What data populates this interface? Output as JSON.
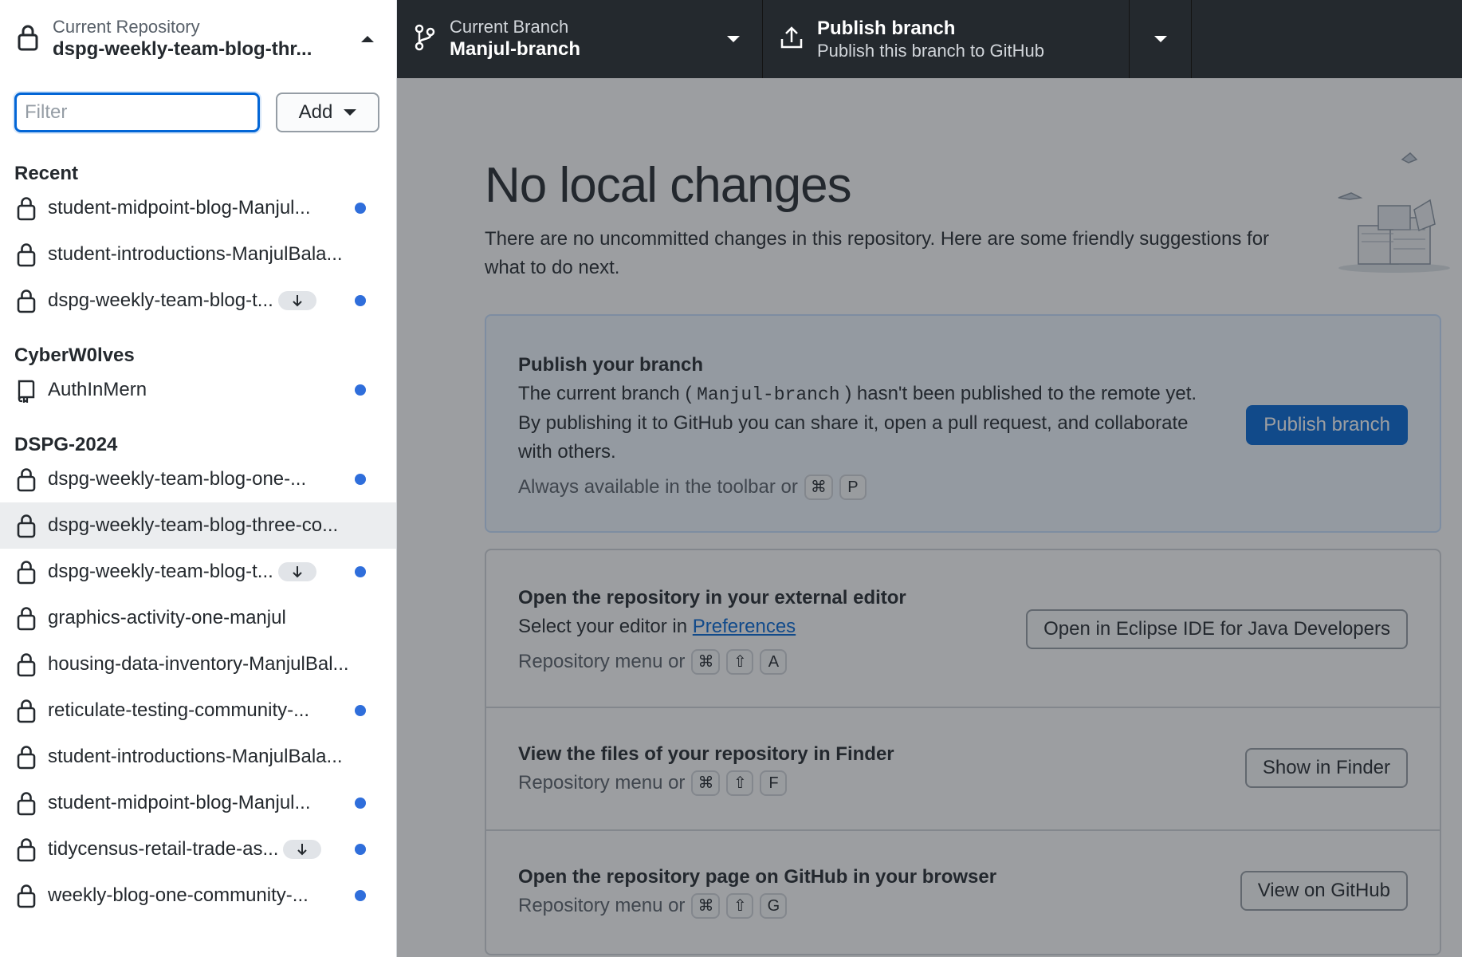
{
  "toolbar": {
    "repo_label": "Current Repository",
    "repo_name": "dspg-weekly-team-blog-thr...",
    "branch_label": "Current Branch",
    "branch_name": "Manjul-branch",
    "publish_title": "Publish branch",
    "publish_subtitle": "Publish this branch to GitHub"
  },
  "sidebar": {
    "filter_placeholder": "Filter",
    "add_label": "Add",
    "groups": [
      {
        "title": "Recent",
        "items": [
          {
            "name": "student-midpoint-blog-Manjul...",
            "icon": "lock-icon",
            "dot": true,
            "pull": false
          },
          {
            "name": "student-introductions-ManjulBala...",
            "icon": "lock-icon",
            "dot": false,
            "pull": false
          },
          {
            "name": "dspg-weekly-team-blog-t...",
            "icon": "lock-icon",
            "dot": true,
            "pull": true
          }
        ]
      },
      {
        "title": "CyberW0lves",
        "items": [
          {
            "name": "AuthInMern",
            "icon": "repo-icon",
            "dot": true,
            "pull": false
          }
        ]
      },
      {
        "title": "DSPG-2024",
        "items": [
          {
            "name": "dspg-weekly-team-blog-one-...",
            "icon": "lock-icon",
            "dot": true,
            "pull": false
          },
          {
            "name": "dspg-weekly-team-blog-three-co...",
            "icon": "lock-icon",
            "dot": false,
            "pull": false,
            "selected": true
          },
          {
            "name": "dspg-weekly-team-blog-t...",
            "icon": "lock-icon",
            "dot": true,
            "pull": true
          },
          {
            "name": "graphics-activity-one-manjul",
            "icon": "lock-icon",
            "dot": false,
            "pull": false
          },
          {
            "name": "housing-data-inventory-ManjulBal...",
            "icon": "lock-icon",
            "dot": false,
            "pull": false
          },
          {
            "name": "reticulate-testing-community-...",
            "icon": "lock-icon",
            "dot": true,
            "pull": false
          },
          {
            "name": "student-introductions-ManjulBala...",
            "icon": "lock-icon",
            "dot": false,
            "pull": false
          },
          {
            "name": "student-midpoint-blog-Manjul...",
            "icon": "lock-icon",
            "dot": true,
            "pull": false
          },
          {
            "name": "tidycensus-retail-trade-as...",
            "icon": "lock-icon",
            "dot": true,
            "pull": true
          },
          {
            "name": "weekly-blog-one-community-...",
            "icon": "lock-icon",
            "dot": true,
            "pull": false
          }
        ]
      }
    ]
  },
  "main": {
    "headline": "No local changes",
    "subtext": "There are no uncommitted changes in this repository. Here are some friendly suggestions for what to do next.",
    "publish": {
      "title": "Publish your branch",
      "desc_before": "The current branch ( ",
      "branch_code": "Manjul-branch",
      "desc_after": " ) hasn't been published to the remote yet. By publishing it to GitHub you can share it, open a pull request, and collaborate with others.",
      "hint": "Always available in the toolbar or",
      "keys": [
        "⌘",
        "P"
      ],
      "button": "Publish branch"
    },
    "editor": {
      "title": "Open the repository in your external editor",
      "desc_prefix": "Select your editor in ",
      "desc_link": "Preferences",
      "hint": "Repository menu or",
      "keys": [
        "⌘",
        "⇧",
        "A"
      ],
      "button": "Open in Eclipse IDE for Java Developers"
    },
    "finder": {
      "title": "View the files of your repository in Finder",
      "hint": "Repository menu or",
      "keys": [
        "⌘",
        "⇧",
        "F"
      ],
      "button": "Show in Finder"
    },
    "github": {
      "title": "Open the repository page on GitHub in your browser",
      "hint": "Repository menu or",
      "keys": [
        "⌘",
        "⇧",
        "G"
      ],
      "button": "View on GitHub"
    }
  },
  "colors": {
    "toolbar_bg": "#24292e",
    "accent": "#0366d6",
    "dot": "#2f6edb"
  }
}
